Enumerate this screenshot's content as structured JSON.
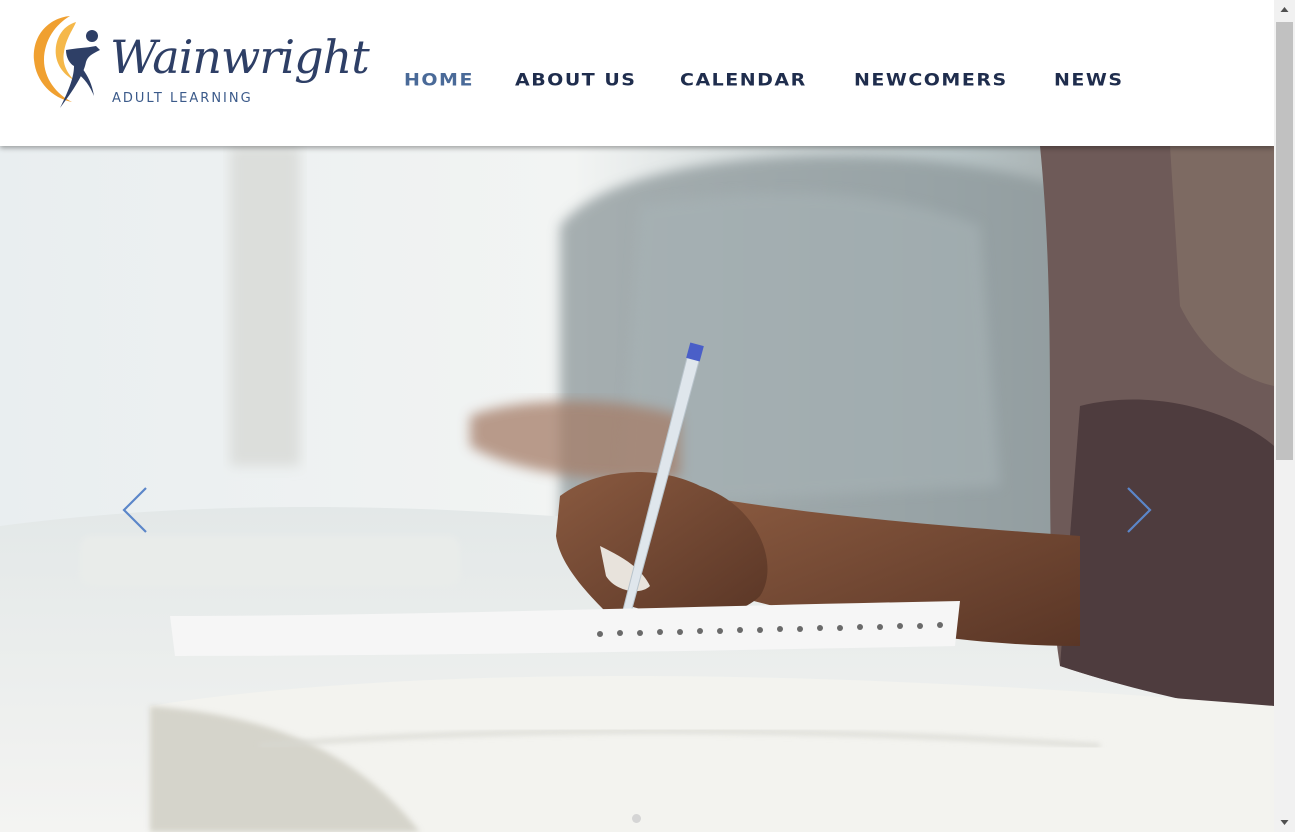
{
  "brand": {
    "name": "Wainwright",
    "tagline": "ADULT LEARNING",
    "colors": {
      "orange": "#f0a030",
      "navy": "#2e3f66",
      "blue": "#3b5a8a"
    }
  },
  "nav": {
    "items": [
      {
        "label": "HOME",
        "active": true
      },
      {
        "label": "ABOUT US",
        "active": false
      },
      {
        "label": "CALENDAR",
        "active": false
      },
      {
        "label": "NEWCOMERS",
        "active": false
      },
      {
        "label": "NEWS",
        "active": false
      }
    ]
  },
  "slideshow": {
    "image_description_icon": "hand-writing-in-notebook-photo",
    "prev_icon": "chevron-left-icon",
    "next_icon": "chevron-right-icon"
  },
  "scrollbar": {
    "up_icon": "triangle-up-icon",
    "down_icon": "triangle-down-icon"
  }
}
